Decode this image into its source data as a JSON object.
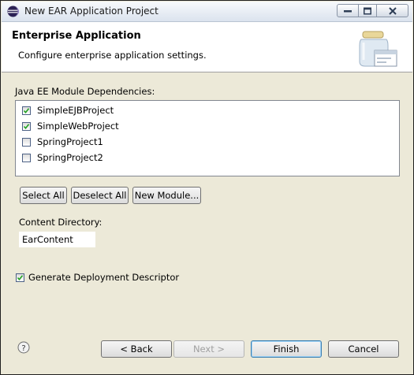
{
  "window": {
    "title": "New EAR Application Project",
    "icon": "eclipse-icon"
  },
  "banner": {
    "title": "Enterprise Application",
    "description": "Configure enterprise application settings.",
    "image": "jar-wizard-icon"
  },
  "dependencies": {
    "label": "Java EE Module Dependencies:",
    "items": [
      {
        "label": "SimpleEJBProject",
        "checked": true
      },
      {
        "label": "SimpleWebProject",
        "checked": true
      },
      {
        "label": "SpringProject1",
        "checked": false
      },
      {
        "label": "SpringProject2",
        "checked": false
      }
    ]
  },
  "buttons": {
    "select_all": "Select All",
    "deselect_all": "Deselect All",
    "new_module": "New Module..."
  },
  "content_directory": {
    "label": "Content Directory:",
    "value": "EarContent"
  },
  "generate_descriptor": {
    "label": "Generate Deployment Descriptor",
    "checked": true
  },
  "footer": {
    "help_icon": "help-icon",
    "back": "< Back",
    "next": "Next >",
    "finish": "Finish",
    "cancel": "Cancel"
  }
}
